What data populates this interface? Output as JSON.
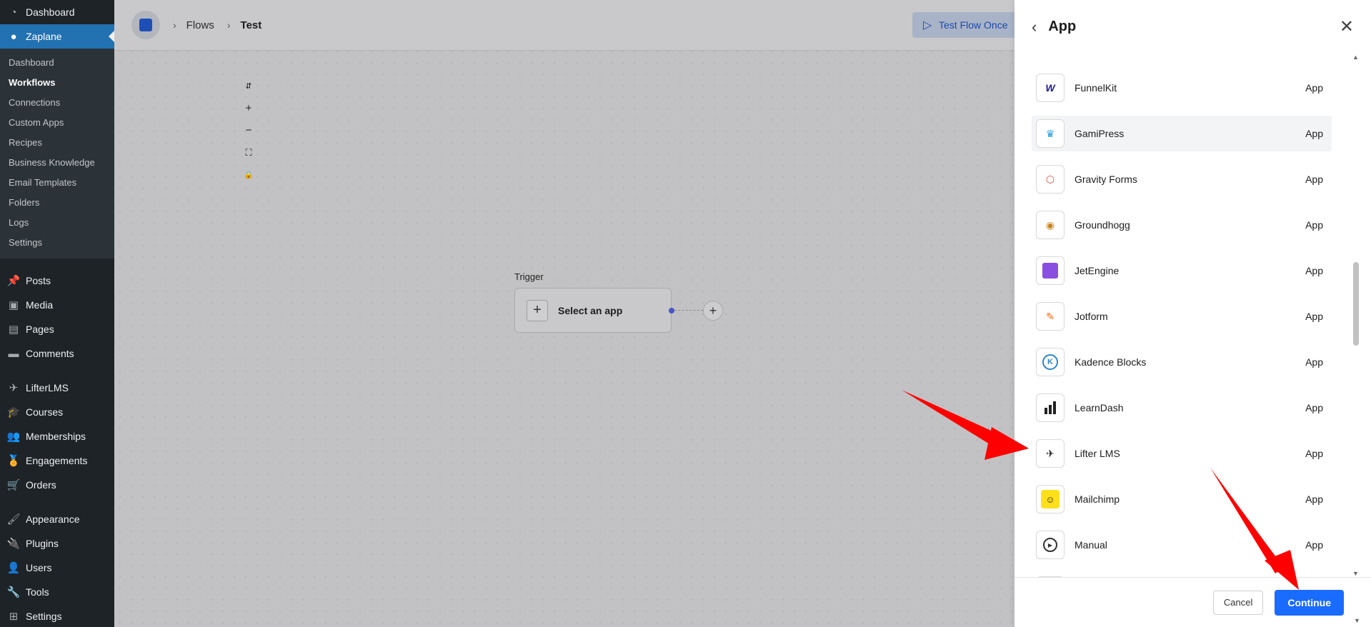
{
  "wp_menu": {
    "dashboard": "Dashboard",
    "zaplane": "Zaplane",
    "submenu": [
      "Dashboard",
      "Workflows",
      "Connections",
      "Custom Apps",
      "Recipes",
      "Business Knowledge",
      "Email Templates",
      "Folders",
      "Logs",
      "Settings"
    ],
    "posts": "Posts",
    "media": "Media",
    "pages": "Pages",
    "comments": "Comments",
    "lifterlms": "LifterLMS",
    "courses": "Courses",
    "memberships": "Memberships",
    "engagements": "Engagements",
    "orders": "Orders",
    "appearance": "Appearance",
    "plugins": "Plugins",
    "users": "Users",
    "tools": "Tools",
    "settings": "Settings"
  },
  "topbar": {
    "breadcrumb_flows": "Flows",
    "breadcrumb_current": "Test",
    "test_button": "Test Flow Once"
  },
  "canvas": {
    "trigger_label": "Trigger",
    "trigger_node_text": "Select an app"
  },
  "panel": {
    "title": "App",
    "apps": [
      {
        "name": "FunnelKit",
        "tag": "App",
        "icon": "funnelkit-icon",
        "color": "#1a1a8a"
      },
      {
        "name": "GamiPress",
        "tag": "App",
        "icon": "gamipress-icon",
        "color": "#1e9bd7"
      },
      {
        "name": "Gravity Forms",
        "tag": "App",
        "icon": "gravity-forms-icon",
        "color": "#e8493f"
      },
      {
        "name": "Groundhogg",
        "tag": "App",
        "icon": "groundhogg-icon",
        "color": "#c9831e"
      },
      {
        "name": "JetEngine",
        "tag": "App",
        "icon": "jetengine-icon",
        "color": "#8a4fe0"
      },
      {
        "name": "Jotform",
        "tag": "App",
        "icon": "jotform-icon",
        "color": "#ff6100"
      },
      {
        "name": "Kadence Blocks",
        "tag": "App",
        "icon": "kadence-icon",
        "color": "#2f86c9"
      },
      {
        "name": "LearnDash",
        "tag": "App",
        "icon": "learndash-icon",
        "color": "#222222"
      },
      {
        "name": "Lifter LMS",
        "tag": "App",
        "icon": "lifterlms-icon",
        "color": "#222222"
      },
      {
        "name": "Mailchimp",
        "tag": "App",
        "icon": "mailchimp-icon",
        "color": "#ffe01b"
      },
      {
        "name": "Manual",
        "tag": "App",
        "icon": "manual-play-icon",
        "color": "#333333"
      }
    ],
    "cancel": "Cancel",
    "continue": "Continue"
  },
  "colors": {
    "accent": "#1a6bff",
    "wp_sidebar": "#1d2327",
    "wp_current": "#2271b1",
    "annotation": "#ff0000"
  }
}
